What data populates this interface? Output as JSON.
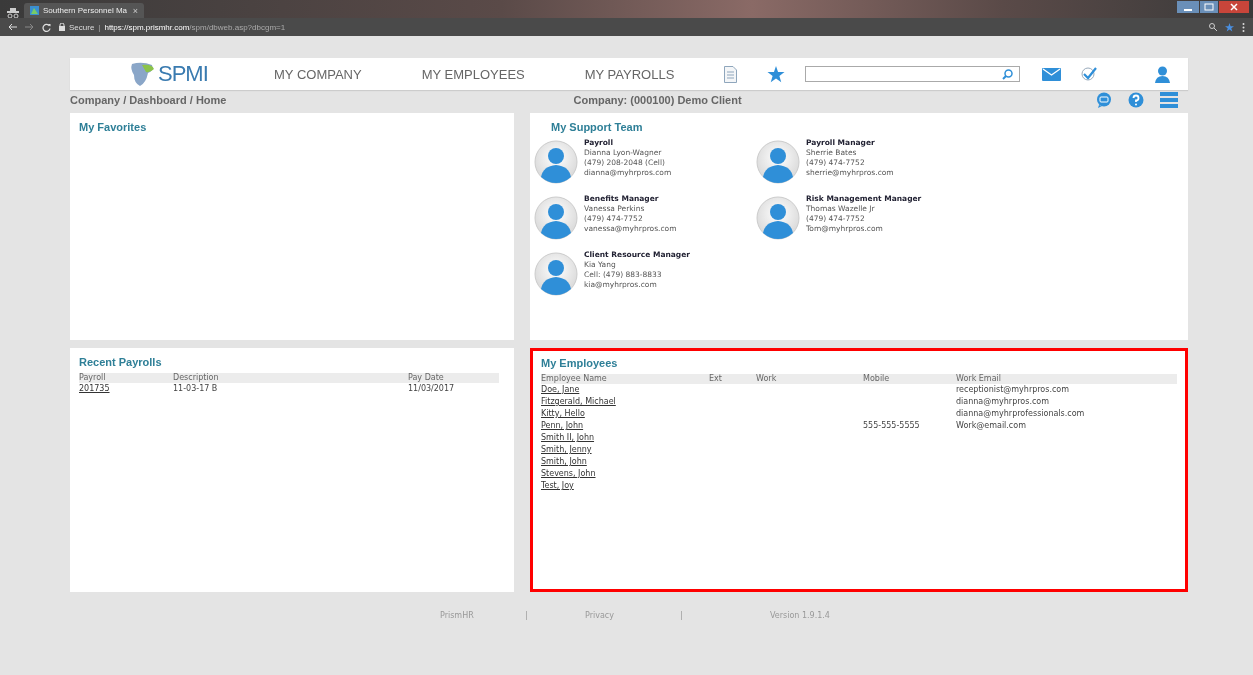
{
  "browser": {
    "tab_title": "Southern Personnel Ma",
    "close_glyph": "×",
    "secure_label": "Secure",
    "url_divider": "|",
    "url_host": "https://spm.prismhr.com",
    "url_path": "/spm/dbweb.asp?dbcgm=1"
  },
  "header": {
    "logo": "SPMI",
    "nav": [
      "MY COMPANY",
      "MY EMPLOYEES",
      "MY PAYROLLS"
    ]
  },
  "breadcrumb": "Company / Dashboard / Home",
  "company": "Company: (000100) Demo Client",
  "favorites": {
    "title": "My Favorites"
  },
  "support_team": {
    "title": "My Support Team",
    "contacts": [
      {
        "role": "Payroll",
        "name": "Dianna Lyon-Wagner",
        "phone": "(479) 208-2048 (Cell)",
        "email": "dianna@myhrpros.com"
      },
      {
        "role": "Payroll Manager",
        "name": "Sherrie Bates",
        "phone": "(479) 474-7752",
        "email": "sherrie@myhrpros.com"
      },
      {
        "role": "Benefits Manager",
        "name": "Vanessa Perkins",
        "phone": "(479) 474-7752",
        "email": "vanessa@myhrpros.com"
      },
      {
        "role": "Risk Management Manager",
        "name": "Thomas Wazelle Jr",
        "phone": "(479) 474-7752",
        "email": "Tom@myhrpros.com"
      },
      {
        "role": "Client Resource Manager",
        "name": "Kia Yang",
        "phone": "Cell: (479) 883-8833",
        "email": "kia@myhrpros.com"
      }
    ]
  },
  "recent_payrolls": {
    "title": "Recent Payrolls",
    "columns": [
      "Payroll",
      "Description",
      "Pay Date"
    ],
    "rows": [
      {
        "payroll": "201735",
        "description": "11-03-17 B",
        "pay_date": "11/03/2017"
      }
    ]
  },
  "my_employees": {
    "title": "My Employees",
    "highlighted": true,
    "columns": [
      "Employee Name",
      "Ext",
      "Work",
      "Mobile",
      "Work Email"
    ],
    "rows": [
      {
        "name": "Doe, Jane",
        "email": "receptionist@myhrpros.com"
      },
      {
        "name": "Fitzgerald, Michael",
        "email": "dianna@myhrpros.com"
      },
      {
        "name": "Kitty, Hello",
        "email": "dianna@myhrprofessionals.com"
      },
      {
        "name": "Penn, John",
        "mobile": "555-555-5555",
        "email": "Work@email.com"
      },
      {
        "name": "Smith II, John"
      },
      {
        "name": "Smith, Jenny"
      },
      {
        "name": "Smith, John"
      },
      {
        "name": "Stevens, John"
      },
      {
        "name": "Test, Joy"
      }
    ]
  },
  "footer": {
    "links": [
      "PrismHR",
      "Privacy"
    ],
    "separators": [
      "|",
      "|"
    ],
    "version": "Version 1.9.1.4"
  }
}
